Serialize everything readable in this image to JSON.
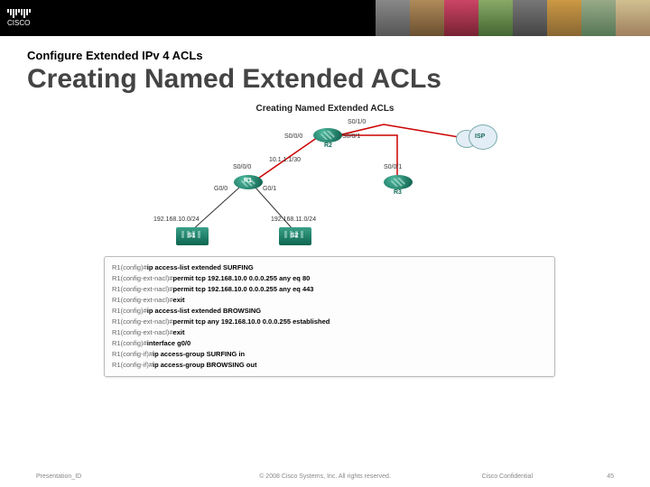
{
  "header": {
    "logo_text": "CISCO"
  },
  "slide": {
    "subtitle": "Configure Extended IPv 4 ACLs",
    "title": "Creating Named Extended ACLs",
    "diagram_title": "Creating Named Extended ACLs"
  },
  "diagram": {
    "routers": {
      "r1": "R1",
      "r2": "R2",
      "r3": "R3",
      "isp": "ISP"
    },
    "switches": {
      "s1": "S1",
      "s2": "S2"
    },
    "labels": {
      "s0_1_0": "S0/1/0",
      "s0_0_0_a": "S0/0/0",
      "s0_0_0_b": "S0/0/0",
      "s0_0_1_a": "S0/0/1",
      "s0_0_1_b": "S0/0/1",
      "g0_0": "G0/0",
      "g0_1": "G0/1",
      "r1r2_net": "10.1.1.1/30",
      "lan1": "192.168.10.0/24",
      "lan2": "192.168.11.0/24"
    }
  },
  "terminal": [
    {
      "p": "R1(config)#",
      "c": "ip access-list extended SURFING"
    },
    {
      "p": "R1(config-ext-nacl)#",
      "c": "permit tcp 192.168.10.0 0.0.0.255 any eq 80"
    },
    {
      "p": "R1(config-ext-nacl)#",
      "c": "permit tcp 192.168.10.0 0.0.0.255 any eq 443"
    },
    {
      "p": "R1(config-ext-nacl)#",
      "c": "exit"
    },
    {
      "p": "R1(config)#",
      "c": "ip access-list extended BROWSING"
    },
    {
      "p": "R1(config-ext-nacl)#",
      "c": "permit tcp any 192.168.10.0 0.0.0.255 established"
    },
    {
      "p": "R1(config-ext-nacl)#",
      "c": "exit"
    },
    {
      "p": "R1(config)#",
      "c": "interface g0/0"
    },
    {
      "p": "R1(config-if)#",
      "c": "ip access-group SURFING in"
    },
    {
      "p": "R1(config-if)#",
      "c": "ip access-group BROWSING out"
    }
  ],
  "footer": {
    "left": "Presentation_ID",
    "center": "© 2008 Cisco Systems, Inc. All rights reserved.",
    "right1": "Cisco Confidential",
    "right2": "45"
  }
}
